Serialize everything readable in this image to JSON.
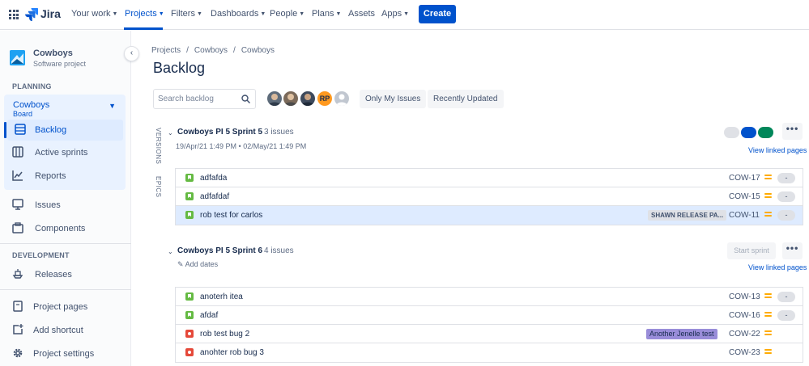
{
  "topnav": {
    "product": "Jira",
    "items": [
      {
        "label": "Your work"
      },
      {
        "label": "Projects"
      },
      {
        "label": "Filters"
      },
      {
        "label": "Dashboards"
      },
      {
        "label": "People"
      },
      {
        "label": "Plans"
      },
      {
        "label": "Assets"
      },
      {
        "label": "Apps"
      }
    ],
    "create_label": "Create"
  },
  "sidebar": {
    "project_name": "Cowboys",
    "project_type": "Software project",
    "planning_label": "PLANNING",
    "board_title": "Cowboys",
    "board_sub": "Board",
    "items": [
      {
        "label": "Backlog",
        "icon": "backlog-icon"
      },
      {
        "label": "Active sprints",
        "icon": "board-columns-icon"
      },
      {
        "label": "Reports",
        "icon": "chart-icon"
      },
      {
        "label": "Issues",
        "icon": "issues-icon"
      },
      {
        "label": "Components",
        "icon": "component-icon"
      }
    ],
    "development_label": "DEVELOPMENT",
    "releases_label": "Releases",
    "bottom_items": [
      {
        "label": "Project pages"
      },
      {
        "label": "Add shortcut"
      },
      {
        "label": "Project settings"
      }
    ]
  },
  "breadcrumb": [
    "Projects",
    "/",
    "Cowboys",
    "/",
    "Cowboys"
  ],
  "page_title": "Backlog",
  "search": {
    "placeholder": "Search backlog",
    "value": ""
  },
  "avatar_initials": "RP",
  "filters": {
    "only_my": "Only My Issues",
    "recent": "Recently Updated"
  },
  "side_tabs": {
    "versions": "VERSIONS",
    "epics": "EPICS"
  },
  "colors": {
    "accent": "#0052cc",
    "story": "#65ba43",
    "bug": "#e5493a",
    "priority_medium": "#ffab00",
    "selected_bg": "#deebff",
    "status_done": "#00875a",
    "status_in_progress": "#0052cc",
    "status_todo": "#dfe1e6"
  },
  "sprints": [
    {
      "name": "Cowboys PI 5 Sprint 5",
      "count": "3 issues",
      "dates": "19/Apr/21 1:49 PM • 02/May/21 1:49 PM",
      "linked": "View linked pages",
      "more": "•••",
      "issues": [
        {
          "type": "story",
          "summary": "adfafda",
          "epic": "",
          "key": "COW-17",
          "estimate": "-"
        },
        {
          "type": "story",
          "summary": "adfafdaf",
          "epic": "",
          "key": "COW-15",
          "estimate": "-"
        },
        {
          "type": "story",
          "summary": "rob test for carlos",
          "epic": "SHAWN RELEASE PA...",
          "key": "COW-11",
          "estimate": "-"
        }
      ]
    },
    {
      "name": "Cowboys PI 5 Sprint 6",
      "count": "4 issues",
      "add_dates": "Add dates",
      "start": "Start sprint",
      "linked": "View linked pages",
      "more": "•••",
      "issues": [
        {
          "type": "story",
          "summary": "anoterh itea",
          "epic": "",
          "key": "COW-13",
          "estimate": "-"
        },
        {
          "type": "story",
          "summary": "afdaf",
          "epic": "",
          "key": "COW-16",
          "estimate": "-"
        },
        {
          "type": "bug",
          "summary": "rob test bug 2",
          "epic": "Another Jenelle test",
          "key": "COW-22",
          "estimate": ""
        },
        {
          "type": "bug",
          "summary": "anohter rob bug 3",
          "epic": "",
          "key": "COW-23",
          "estimate": ""
        }
      ]
    }
  ]
}
